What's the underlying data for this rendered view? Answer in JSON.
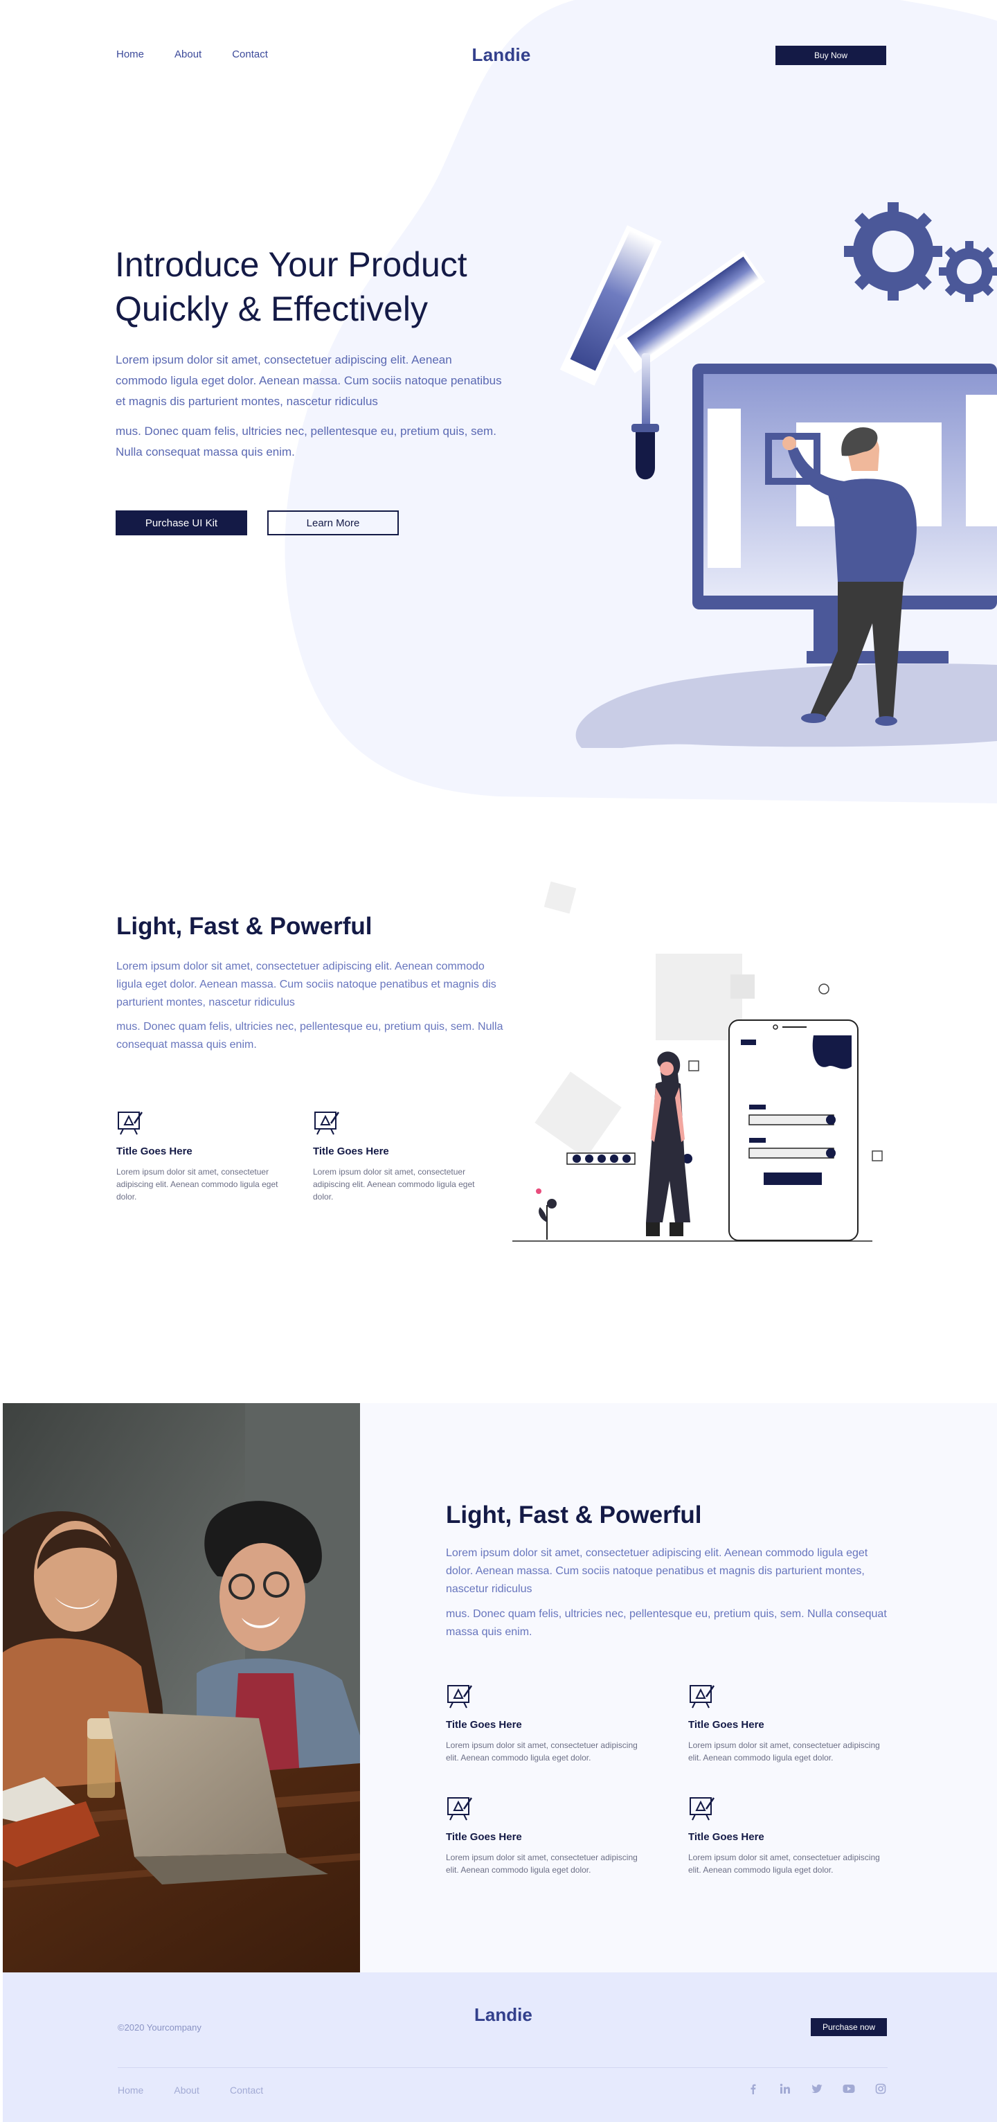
{
  "nav": {
    "links": [
      "Home",
      "About",
      "Contact"
    ],
    "logo": "Landie",
    "cta": "Buy Now"
  },
  "hero": {
    "title_line1": "Introduce Your Product",
    "title_line2": "Quickly & Effectively",
    "paragraph1": "Lorem ipsum dolor sit amet, consectetuer adipiscing elit. Aenean commodo ligula eget dolor. Aenean massa. Cum sociis natoque penatibus et magnis dis parturient montes, nascetur ridiculus",
    "paragraph2": "mus. Donec quam felis, ultricies nec, pellentesque eu, pretium quis, sem. Nulla consequat massa quis enim.",
    "primary_button": "Purchase UI Kit",
    "secondary_button": "Learn More"
  },
  "section2": {
    "title": "Light, Fast & Powerful",
    "paragraph1": "Lorem ipsum dolor sit amet, consectetuer adipiscing elit. Aenean commodo ligula eget dolor. Aenean massa. Cum sociis natoque penatibus et magnis dis parturient montes, nascetur ridiculus",
    "paragraph2": "mus. Donec quam felis, ultricies nec, pellentesque eu, pretium quis, sem. Nulla consequat massa quis enim.",
    "features": [
      {
        "title": "Title Goes Here",
        "desc": "Lorem ipsum dolor sit amet, consectetuer adipiscing elit. Aenean commodo ligula eget dolor."
      },
      {
        "title": "Title Goes Here",
        "desc": "Lorem ipsum dolor sit amet, consectetuer adipiscing elit. Aenean commodo ligula eget dolor."
      }
    ]
  },
  "section3": {
    "title": "Light, Fast & Powerful",
    "paragraph1": "Lorem ipsum dolor sit amet, consectetuer adipiscing elit. Aenean commodo ligula eget dolor. Aenean massa. Cum sociis natoque penatibus et magnis dis parturient montes, nascetur ridiculus",
    "paragraph2": "mus. Donec quam felis, ultricies nec, pellentesque eu, pretium quis, sem. Nulla consequat massa quis enim.",
    "features": [
      {
        "title": "Title Goes Here",
        "desc": "Lorem ipsum dolor sit amet, consectetuer adipiscing elit. Aenean commodo ligula eget dolor."
      },
      {
        "title": "Title Goes Here",
        "desc": "Lorem ipsum dolor sit amet, consectetuer adipiscing elit. Aenean commodo ligula eget dolor."
      },
      {
        "title": "Title Goes Here",
        "desc": "Lorem ipsum dolor sit amet, consectetuer adipiscing elit. Aenean commodo ligula eget dolor."
      },
      {
        "title": "Title Goes Here",
        "desc": "Lorem ipsum dolor sit amet, consectetuer adipiscing elit. Aenean commodo ligula eget dolor."
      }
    ]
  },
  "footer": {
    "copyright": "©2020 Yourcompany",
    "logo": "Landie",
    "cta": "Purchase now",
    "links": [
      "Home",
      "About",
      "Contact"
    ],
    "social_icons": [
      "facebook-icon",
      "linkedin-icon",
      "twitter-icon",
      "youtube-icon",
      "instagram-icon"
    ]
  },
  "colors": {
    "navy": "#141a46",
    "brand": "#33408c",
    "accent": "#4b5899",
    "text_blue": "#5a68b2",
    "hero_bg": "#f3f5fe",
    "footer_bg": "#e6eafd"
  }
}
